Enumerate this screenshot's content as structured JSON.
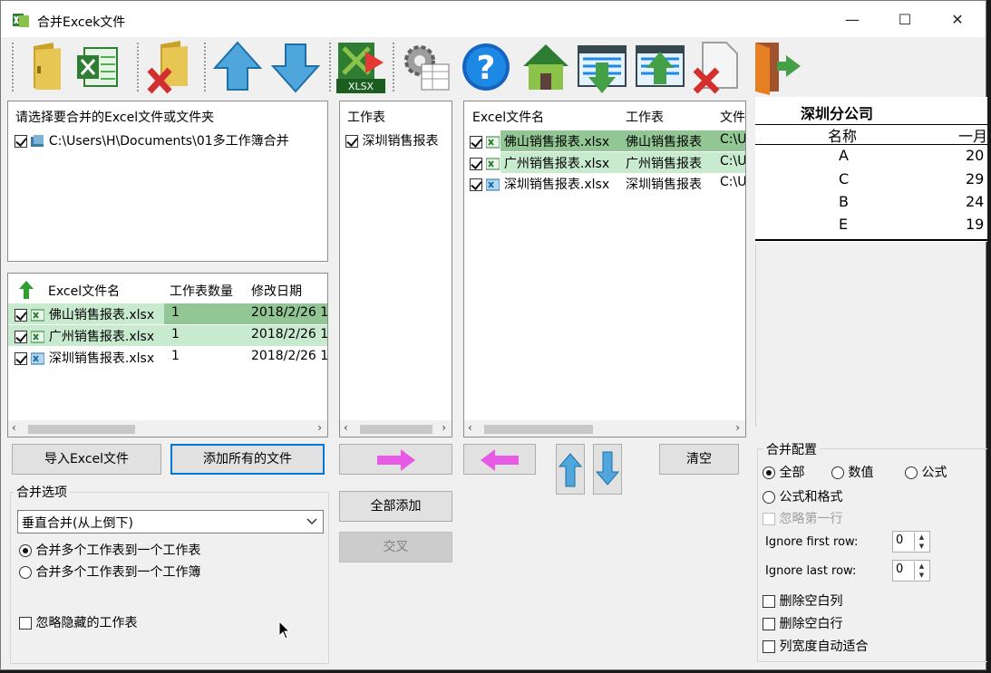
{
  "window": {
    "title": "合并Excek文件",
    "minimize": "—",
    "maximize": "☐",
    "close": "✕"
  },
  "colors": {
    "selected_row_green": "#92c695",
    "alt_row_green": "#c8ebcf",
    "accent": "#0078d7",
    "arrow_magenta": "#e65ae6"
  },
  "toolbar": {
    "icons": [
      "folder-open-icon",
      "excel-file-icon",
      "folder-delete-icon",
      "arrow-up-icon",
      "arrow-down-icon",
      "xlsx-export-icon",
      "settings-gear-icon",
      "help-icon",
      "home-icon",
      "sheet-download-icon",
      "sheet-upload-icon",
      "file-delete-icon",
      "exit-door-icon"
    ]
  },
  "folder_panel": {
    "heading": "请选择要合并的Excel文件或文件夹",
    "items": [
      {
        "checked": true,
        "path": "C:\\Users\\H\\Documents\\01多工作簿合并"
      }
    ]
  },
  "file_table": {
    "columns": [
      "Excel文件名",
      "工作表数量",
      "修改日期"
    ],
    "rows": [
      {
        "checked": true,
        "name": "佛山销售报表.xlsx",
        "count": "1",
        "date": "2018/2/26 1:"
      },
      {
        "checked": true,
        "name": "广州销售报表.xlsx",
        "count": "1",
        "date": "2018/2/26 1:"
      },
      {
        "checked": true,
        "name": "深圳销售报表.xlsx",
        "count": "1",
        "date": "2018/2/26 1:"
      }
    ]
  },
  "sheet_panel": {
    "heading": "工作表",
    "items": [
      {
        "checked": true,
        "label": "深圳销售报表"
      }
    ]
  },
  "merge_list": {
    "columns": [
      "Excel文件名",
      "工作表",
      "文件"
    ],
    "rows": [
      {
        "checked": true,
        "name": "佛山销售报表.xlsx",
        "sheet": "佛山销售报表",
        "path": "C:\\U"
      },
      {
        "checked": true,
        "name": "广州销售报表.xlsx",
        "sheet": "广州销售报表",
        "path": "C:\\U"
      },
      {
        "checked": true,
        "name": "深圳销售报表.xlsx",
        "sheet": "深圳销售报表",
        "path": "C:\\U"
      }
    ]
  },
  "preview": {
    "title": "深圳分公司",
    "header": [
      "名称",
      "一月"
    ],
    "rows": [
      [
        "A",
        "20"
      ],
      [
        "C",
        "29"
      ],
      [
        "B",
        "24"
      ],
      [
        "E",
        "19"
      ]
    ]
  },
  "buttons": {
    "import_excel": "导入Excel文件",
    "add_all_files": "添加所有的文件",
    "add_all": "全部添加",
    "cross": "交叉",
    "clear": "清空"
  },
  "merge_options": {
    "group_label": "合并选项",
    "mode_select": "垂直合并(从上倒下)",
    "radio_multi_sheet": "合并多个工作表到一个工作表",
    "radio_multi_book": "合并多个工作表到一个工作簿",
    "ignore_hidden": "忽略隐藏的工作表"
  },
  "merge_config": {
    "group_label": "合并配置",
    "radio_all": "全部",
    "radio_values": "数值",
    "radio_formula": "公式",
    "radio_formula_format": "公式和格式",
    "ignore_first_row": "忽略第一行",
    "ignore_first_row_label": "Ignore first row:",
    "ignore_first_row_value": "0",
    "ignore_last_row_label": "Ignore last row:",
    "ignore_last_row_value": "0",
    "delete_blank_cols": "删除空白列",
    "delete_blank_rows": "删除空白行",
    "autofit_cols": "列宽度自动适合"
  }
}
